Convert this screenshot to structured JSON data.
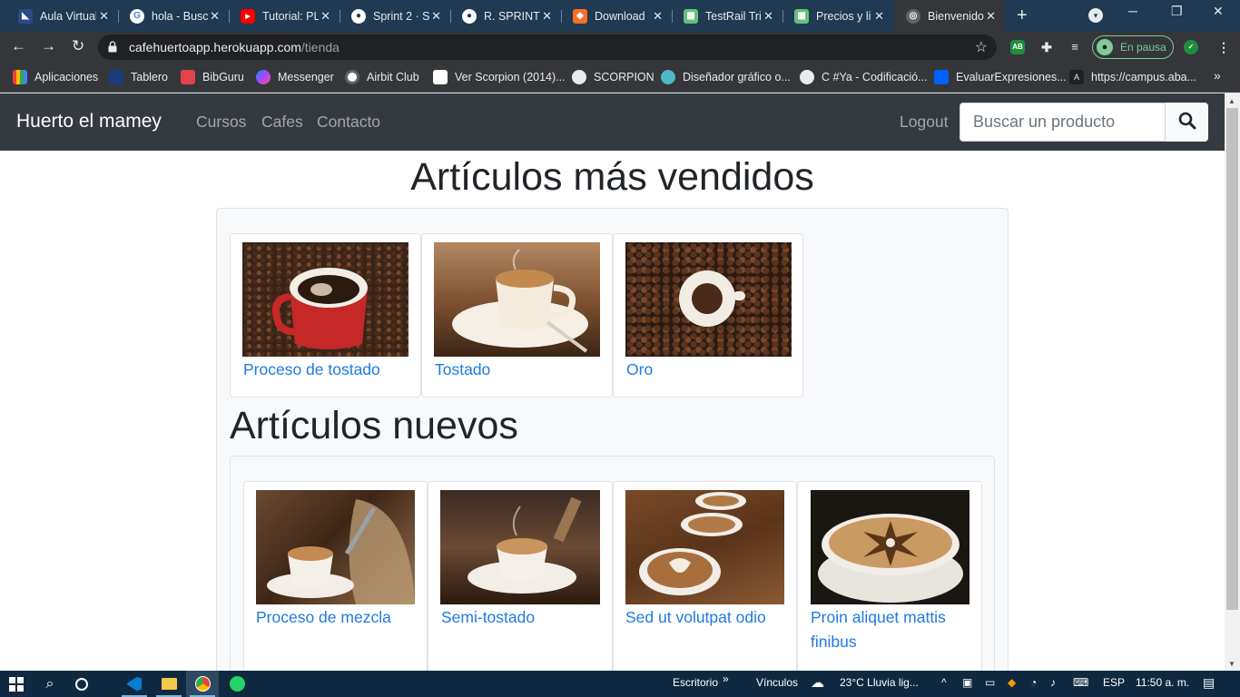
{
  "browser": {
    "tabs": [
      {
        "title": "Aula Virtual",
        "icon": "aula-icon",
        "color": "#3b5998"
      },
      {
        "title": "hola - Buscar",
        "icon": "google-icon",
        "color": "#ffffff"
      },
      {
        "title": "Tutorial: PL",
        "icon": "youtube-icon",
        "color": "#ff0000"
      },
      {
        "title": "Sprint 2 · S",
        "icon": "github-icon",
        "color": "#ffffff"
      },
      {
        "title": "R. SPRINT",
        "icon": "github-icon",
        "color": "#ffffff"
      },
      {
        "title": "Download",
        "icon": "gitlab-icon",
        "color": "#fc6d26"
      },
      {
        "title": "TestRail Tri",
        "icon": "testrail-icon",
        "color": "#65c179"
      },
      {
        "title": "Precios y li",
        "icon": "testrail-icon",
        "color": "#65c179"
      },
      {
        "title": "Bienvenido",
        "icon": "globe-icon",
        "color": "#9aa0a6"
      }
    ],
    "url_host": "cafehuertoapp.herokuapp.com",
    "url_path": "/tienda",
    "profile_status": "En pausa",
    "bookmarks": [
      {
        "label": "Aplicaciones",
        "icon": "apps-icon",
        "color": "#ea4335"
      },
      {
        "label": "Tablero",
        "icon": "tablero-icon",
        "color": "#1a3d7a"
      },
      {
        "label": "BibGuru",
        "icon": "bibguru-icon",
        "color": "#e0434b"
      },
      {
        "label": "Messenger",
        "icon": "messenger-icon",
        "color": "#a845ff"
      },
      {
        "label": "Airbit Club",
        "icon": "airbit-icon",
        "color": "#ffffff"
      },
      {
        "label": "Ver Scorpion (2014)...",
        "icon": "scorpion-icon",
        "color": "#ffffff"
      },
      {
        "label": "SCORPION",
        "icon": "globe-icon",
        "color": "#e8eaed"
      },
      {
        "label": "Diseñador gráfico o...",
        "icon": "designer-icon",
        "color": "#4fb8c9"
      },
      {
        "label": "C #Ya - Codificació...",
        "icon": "globe-icon",
        "color": "#e8eaed"
      },
      {
        "label": "EvaluarExpresiones...",
        "icon": "dropbox-icon",
        "color": "#0061ff"
      },
      {
        "label": "https://campus.aba...",
        "icon": "campus-icon",
        "color": "#202124"
      }
    ]
  },
  "site": {
    "brand": "Huerto el mamey",
    "nav": [
      "Cursos",
      "Cafes",
      "Contacto"
    ],
    "logout": "Logout",
    "search_placeholder": "Buscar un producto"
  },
  "sections": {
    "best_title": "Artículos más vendidos",
    "new_title": "Artículos nuevos",
    "best": [
      {
        "title": "Proceso de tostado",
        "image": "red-cup-on-beans"
      },
      {
        "title": "Tostado",
        "image": "cup-on-saucer-beans"
      },
      {
        "title": "Oro",
        "image": "ground-coffee-cup-top-view"
      }
    ],
    "new": [
      {
        "title": "Proceso de mezcla",
        "image": "espresso-with-bean-sack"
      },
      {
        "title": "Semi-tostado",
        "image": "steaming-coffee-with-beans"
      },
      {
        "title": "Sed ut volutpat odio",
        "image": "latte-art-cups-row"
      },
      {
        "title": "Proin aliquet mattis finibus",
        "image": "latte-art-star"
      }
    ]
  },
  "taskbar": {
    "desktop": "Escritorio",
    "links": "Vínculos",
    "weather": "23°C  Lluvia lig...",
    "language": "ESP",
    "time": "11:50 a. m."
  }
}
